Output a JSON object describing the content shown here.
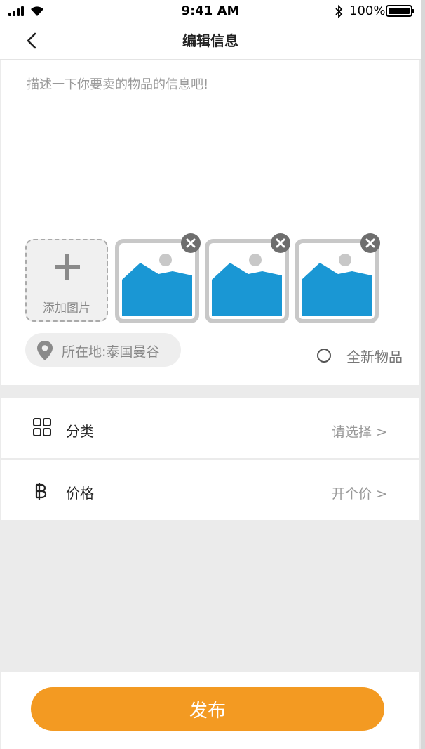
{
  "status_bar": {
    "time": "9:41 AM",
    "battery_percent": "100%",
    "icons": [
      "signal-icon",
      "wifi-icon",
      "bluetooth-icon",
      "battery-icon"
    ]
  },
  "nav": {
    "title": "编辑信息",
    "back_icon": "chevron-left-icon"
  },
  "editor": {
    "description_placeholder": "描述一下你要卖的物品的信息吧!",
    "description_value": "",
    "add_photo_label": "添加图片",
    "photo_count": 3,
    "location_label": "所在地:泰国曼谷",
    "brand_new_label": "全新物品",
    "brand_new_checked": false
  },
  "options": {
    "category": {
      "label": "分类",
      "value": "请选择 >",
      "icon": "grid-icon"
    },
    "price": {
      "label": "价格",
      "value": "开个价 >",
      "icon": "baht-icon"
    }
  },
  "footer": {
    "publish_label": "发布"
  },
  "colors": {
    "accent": "#f39a22",
    "image_placeholder": "#1a97d4",
    "background": "#ebebeb"
  }
}
